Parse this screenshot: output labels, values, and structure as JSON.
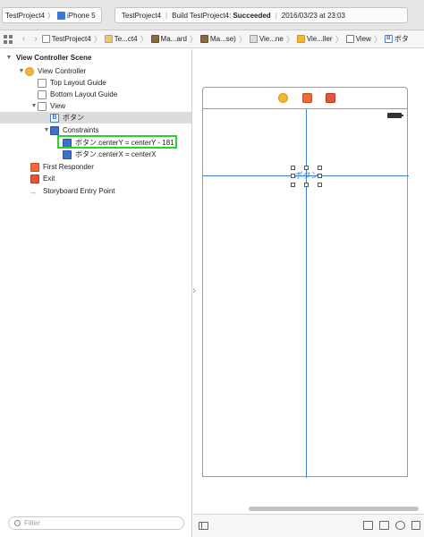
{
  "toolbar": {
    "scheme_name": "TestProject4",
    "scheme_separator": "〉",
    "device_name": "iPhone 5",
    "activity_project": "TestProject4",
    "activity_separator": "|",
    "activity_build_label": "Build TestProject4:",
    "activity_status": "Succeeded",
    "activity_timestamp": "2016/03/23 at 23:03"
  },
  "jumpbar": {
    "back_arrow": "‹",
    "forward_arrow": "›",
    "chevron": "〉",
    "crumbs": [
      {
        "label": "TestProject4",
        "icon": "project-file-icon"
      },
      {
        "label": "Te...ct4",
        "icon": "folder-icon"
      },
      {
        "label": "Ma...ard",
        "icon": "storyboard-icon"
      },
      {
        "label": "Ma...se)",
        "icon": "storyboard-icon"
      },
      {
        "label": "Vie...ne",
        "icon": "scene-icon"
      },
      {
        "label": "Vie...ller",
        "icon": "view-controller-icon"
      },
      {
        "label": "View",
        "icon": "view-icon"
      },
      {
        "label": "ボタ",
        "icon": "button-icon"
      }
    ]
  },
  "outline": {
    "disclosure_open": "▼",
    "disclosure_closed": "▶",
    "entry_arrow": "→",
    "button_glyph": "B",
    "rows": [
      {
        "label": "View Controller Scene"
      },
      {
        "label": "View Controller"
      },
      {
        "label": "Top Layout Guide"
      },
      {
        "label": "Bottom Layout Guide"
      },
      {
        "label": "View"
      },
      {
        "label": "ボタン"
      },
      {
        "label": "Constraints"
      },
      {
        "label": "ボタン.centerY = centerY - 181"
      },
      {
        "label": "ボタン.centerX = centerX"
      },
      {
        "label": "First Responder"
      },
      {
        "label": "Exit"
      },
      {
        "label": "Storyboard Entry Point"
      }
    ],
    "filter_placeholder": "Filter"
  },
  "canvas": {
    "collapse_arrow": "›",
    "button_label": "ボタン"
  },
  "colors": {
    "highlight": "#28d428",
    "guide": "#3f7fd8",
    "button_text": "#2e7bd8"
  }
}
